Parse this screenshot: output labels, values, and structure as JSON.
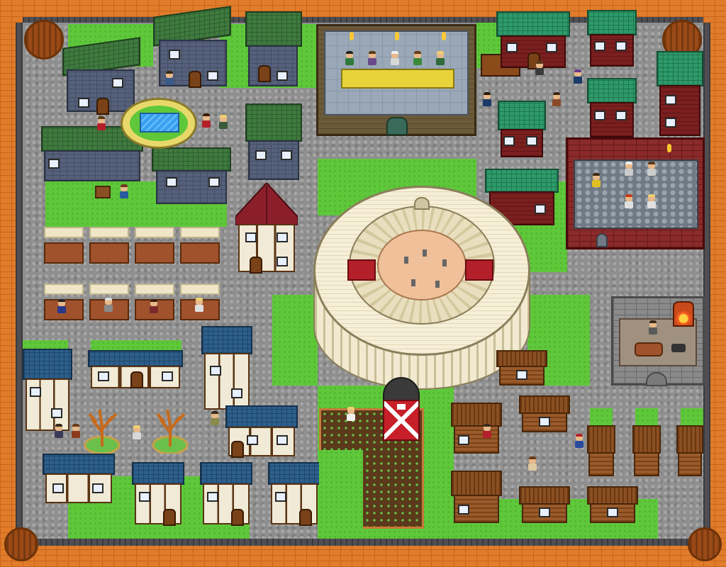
{
  "scene": {
    "type": "top-down pixel-art town map",
    "palette": {
      "grass": "#5ec83a",
      "cobblestone": "#8f8f8f",
      "outer_wall": "#e07c2a",
      "colosseum": "#f2ead0",
      "arena_floor": "#f0c09a",
      "banner_red": "#b3202a",
      "barn_red": "#c8202a",
      "castle_brick": "#8a2a2a",
      "water": "#3aa0f0"
    },
    "buildings": [
      {
        "kind": "colosseum",
        "icon": "colosseum-icon"
      },
      {
        "kind": "council-hall",
        "icon": "throne-hall-icon"
      },
      {
        "kind": "training-courtyard",
        "icon": "courtyard-icon"
      },
      {
        "kind": "blacksmith",
        "icon": "anvil-icon"
      },
      {
        "kind": "barn",
        "icon": "barn-icon"
      },
      {
        "kind": "tudor-inn",
        "icon": "inn-icon"
      }
    ],
    "features": [
      "fountain-pool",
      "market-stalls",
      "crop-field",
      "bare-trees",
      "corner-towers"
    ]
  }
}
